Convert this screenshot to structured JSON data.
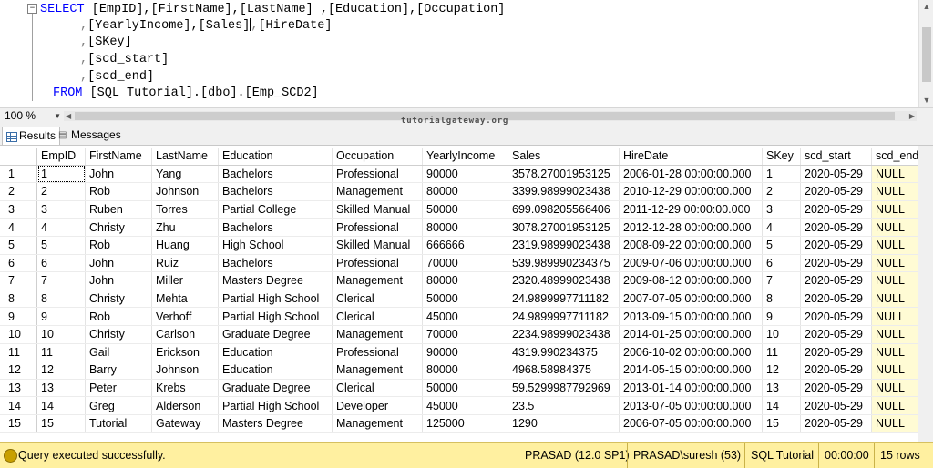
{
  "editor": {
    "line1": {
      "kw": "SELECT",
      "cols": "[EmpID],[FirstName],[LastName] ,[Education],[Occupation]"
    },
    "line2": {
      "pre": ",",
      "cols": "[YearlyIncome],[Sales]",
      "mid": ",",
      "cols2": "[HireDate]"
    },
    "line3": {
      "pre": ",",
      "cols": "[SKey]"
    },
    "line4": {
      "pre": ",",
      "cols": "[scd_start]"
    },
    "line5": {
      "pre": ",",
      "cols": "[scd_end]"
    },
    "line6": {
      "kw": "FROM",
      "cols": "[SQL Tutorial].[dbo].[Emp_SCD2]"
    },
    "collapse_glyph": "−"
  },
  "zoom": {
    "value": "100 %"
  },
  "watermark": "tutorialgateway.org",
  "tabs": {
    "results": "Results",
    "messages": "Messages"
  },
  "grid": {
    "columns": [
      "EmpID",
      "FirstName",
      "LastName",
      "Education",
      "Occupation",
      "YearlyIncome",
      "Sales",
      "HireDate",
      "SKey",
      "scd_start",
      "scd_end"
    ],
    "rows": [
      [
        "1",
        "1",
        "John",
        "Yang",
        "Bachelors",
        "Professional",
        "90000",
        "3578.27001953125",
        "2006-01-28 00:00:00.000",
        "1",
        "2020-05-29",
        "NULL"
      ],
      [
        "2",
        "2",
        "Rob",
        "Johnson",
        "Bachelors",
        "Management",
        "80000",
        "3399.98999023438",
        "2010-12-29 00:00:00.000",
        "2",
        "2020-05-29",
        "NULL"
      ],
      [
        "3",
        "3",
        "Ruben",
        "Torres",
        "Partial College",
        "Skilled Manual",
        "50000",
        "699.098205566406",
        "2011-12-29 00:00:00.000",
        "3",
        "2020-05-29",
        "NULL"
      ],
      [
        "4",
        "4",
        "Christy",
        "Zhu",
        "Bachelors",
        "Professional",
        "80000",
        "3078.27001953125",
        "2012-12-28 00:00:00.000",
        "4",
        "2020-05-29",
        "NULL"
      ],
      [
        "5",
        "5",
        "Rob",
        "Huang",
        "High School",
        "Skilled Manual",
        "666666",
        "2319.98999023438",
        "2008-09-22 00:00:00.000",
        "5",
        "2020-05-29",
        "NULL"
      ],
      [
        "6",
        "6",
        "John",
        "Ruiz",
        "Bachelors",
        "Professional",
        "70000",
        "539.989990234375",
        "2009-07-06 00:00:00.000",
        "6",
        "2020-05-29",
        "NULL"
      ],
      [
        "7",
        "7",
        "John",
        "Miller",
        "Masters Degree",
        "Management",
        "80000",
        "2320.48999023438",
        "2009-08-12 00:00:00.000",
        "7",
        "2020-05-29",
        "NULL"
      ],
      [
        "8",
        "8",
        "Christy",
        "Mehta",
        "Partial High School",
        "Clerical",
        "50000",
        "24.9899997711182",
        "2007-07-05 00:00:00.000",
        "8",
        "2020-05-29",
        "NULL"
      ],
      [
        "9",
        "9",
        "Rob",
        "Verhoff",
        "Partial High School",
        "Clerical",
        "45000",
        "24.9899997711182",
        "2013-09-15 00:00:00.000",
        "9",
        "2020-05-29",
        "NULL"
      ],
      [
        "10",
        "10",
        "Christy",
        "Carlson",
        "Graduate Degree",
        "Management",
        "70000",
        "2234.98999023438",
        "2014-01-25 00:00:00.000",
        "10",
        "2020-05-29",
        "NULL"
      ],
      [
        "11",
        "11",
        "Gail",
        "Erickson",
        "Education",
        "Professional",
        "90000",
        "4319.990234375",
        "2006-10-02 00:00:00.000",
        "11",
        "2020-05-29",
        "NULL"
      ],
      [
        "12",
        "12",
        "Barry",
        "Johnson",
        "Education",
        "Management",
        "80000",
        "4968.58984375",
        "2014-05-15 00:00:00.000",
        "12",
        "2020-05-29",
        "NULL"
      ],
      [
        "13",
        "13",
        "Peter",
        "Krebs",
        "Graduate Degree",
        "Clerical",
        "50000",
        "59.5299987792969",
        "2013-01-14 00:00:00.000",
        "13",
        "2020-05-29",
        "NULL"
      ],
      [
        "14",
        "14",
        "Greg",
        "Alderson",
        "Partial High School",
        "Developer",
        "45000",
        "23.5",
        "2013-07-05 00:00:00.000",
        "14",
        "2020-05-29",
        "NULL"
      ],
      [
        "15",
        "15",
        "Tutorial",
        "Gateway",
        "Masters Degree",
        "Management",
        "125000",
        "1290",
        "2006-07-05 00:00:00.000",
        "15",
        "2020-05-29",
        "NULL"
      ]
    ]
  },
  "status": {
    "message": "Query executed successfully.",
    "server": "PRASAD (12.0 SP1)",
    "user": "PRASAD\\suresh (53)",
    "database": "SQL Tutorial",
    "elapsed": "00:00:00",
    "rows": "15 rows"
  }
}
